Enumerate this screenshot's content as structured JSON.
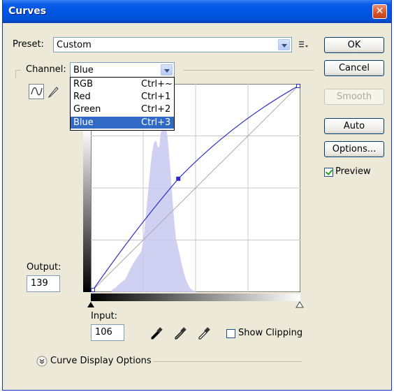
{
  "window": {
    "title": "Curves",
    "close_glyph": "✕"
  },
  "preset": {
    "label": "Preset:",
    "value": "Custom",
    "menu_icon": "preset-menu-icon"
  },
  "channel": {
    "label": "Channel:",
    "value": "Blue",
    "options": [
      {
        "name": "RGB",
        "shortcut": "Ctrl+~"
      },
      {
        "name": "Red",
        "shortcut": "Ctrl+1"
      },
      {
        "name": "Green",
        "shortcut": "Ctrl+2"
      },
      {
        "name": "Blue",
        "shortcut": "Ctrl+3"
      }
    ]
  },
  "buttons": {
    "ok": "OK",
    "cancel": "Cancel",
    "smooth": "Smooth",
    "auto": "Auto",
    "options": "Options..."
  },
  "preview": {
    "label": "Preview",
    "checked": true
  },
  "output": {
    "label": "Output:",
    "value": "139"
  },
  "input": {
    "label": "Input:",
    "value": "106"
  },
  "show_clipping": {
    "label": "Show Clipping",
    "checked": false
  },
  "curve_display": {
    "label": "Curve Display Options",
    "expanded": false
  },
  "curve": {
    "channel_color": "#2A2AC8",
    "point_input": 106,
    "point_output": 139,
    "start_point": [
      0,
      0
    ],
    "end_point": [
      255,
      255
    ],
    "grid_divisions": 4
  },
  "colors": {
    "title_bar": "#0054E3",
    "dialog_bg": "#ECE9D8",
    "selection": "#316AC5",
    "histogram": "#C8C8F0"
  },
  "icons": {
    "curve_tool": "curve-tool-icon",
    "pencil_tool": "pencil-tool-icon",
    "black_eyedropper": "eyedropper-black-icon",
    "gray_eyedropper": "eyedropper-gray-icon",
    "white_eyedropper": "eyedropper-white-icon",
    "expand": "chevron-down-circle-icon"
  }
}
